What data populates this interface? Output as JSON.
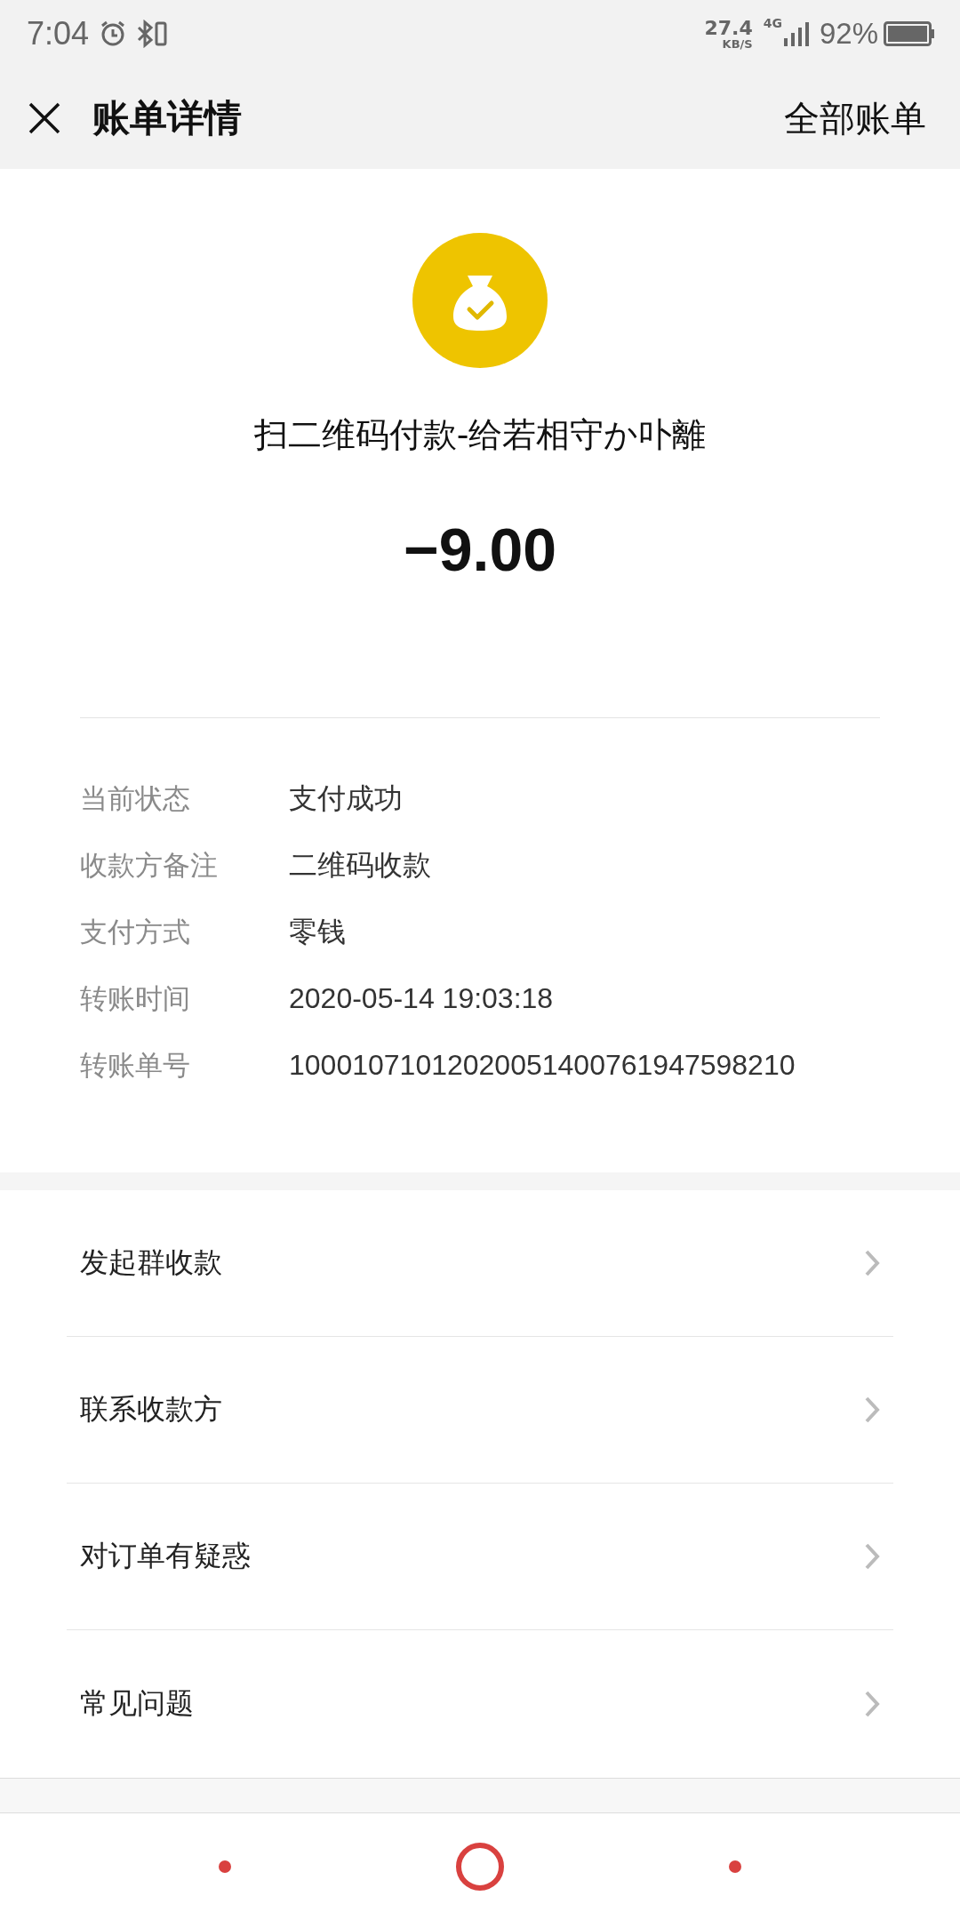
{
  "status_bar": {
    "time": "7:04",
    "speed": "27.4",
    "speed_unit": "KB/S",
    "network": "4G",
    "battery": "92%"
  },
  "header": {
    "title": "账单详情",
    "action": "全部账单"
  },
  "summary": {
    "title": "扫二维码付款-给若相守か卟離",
    "amount": "−9.00"
  },
  "details": [
    {
      "label": "当前状态",
      "value": "支付成功"
    },
    {
      "label": "收款方备注",
      "value": "二维码收款"
    },
    {
      "label": "支付方式",
      "value": "零钱"
    },
    {
      "label": "转账时间",
      "value": "2020-05-14 19:03:18"
    },
    {
      "label": "转账单号",
      "value": "10001071012020051400761947598210"
    }
  ],
  "menu": [
    {
      "label": "发起群收款"
    },
    {
      "label": "联系收款方"
    },
    {
      "label": "对订单有疑惑"
    },
    {
      "label": "常见问题"
    }
  ],
  "nav_bar": [
    {
      "kind": "dot"
    },
    {
      "kind": "ring"
    },
    {
      "kind": "dot"
    }
  ]
}
